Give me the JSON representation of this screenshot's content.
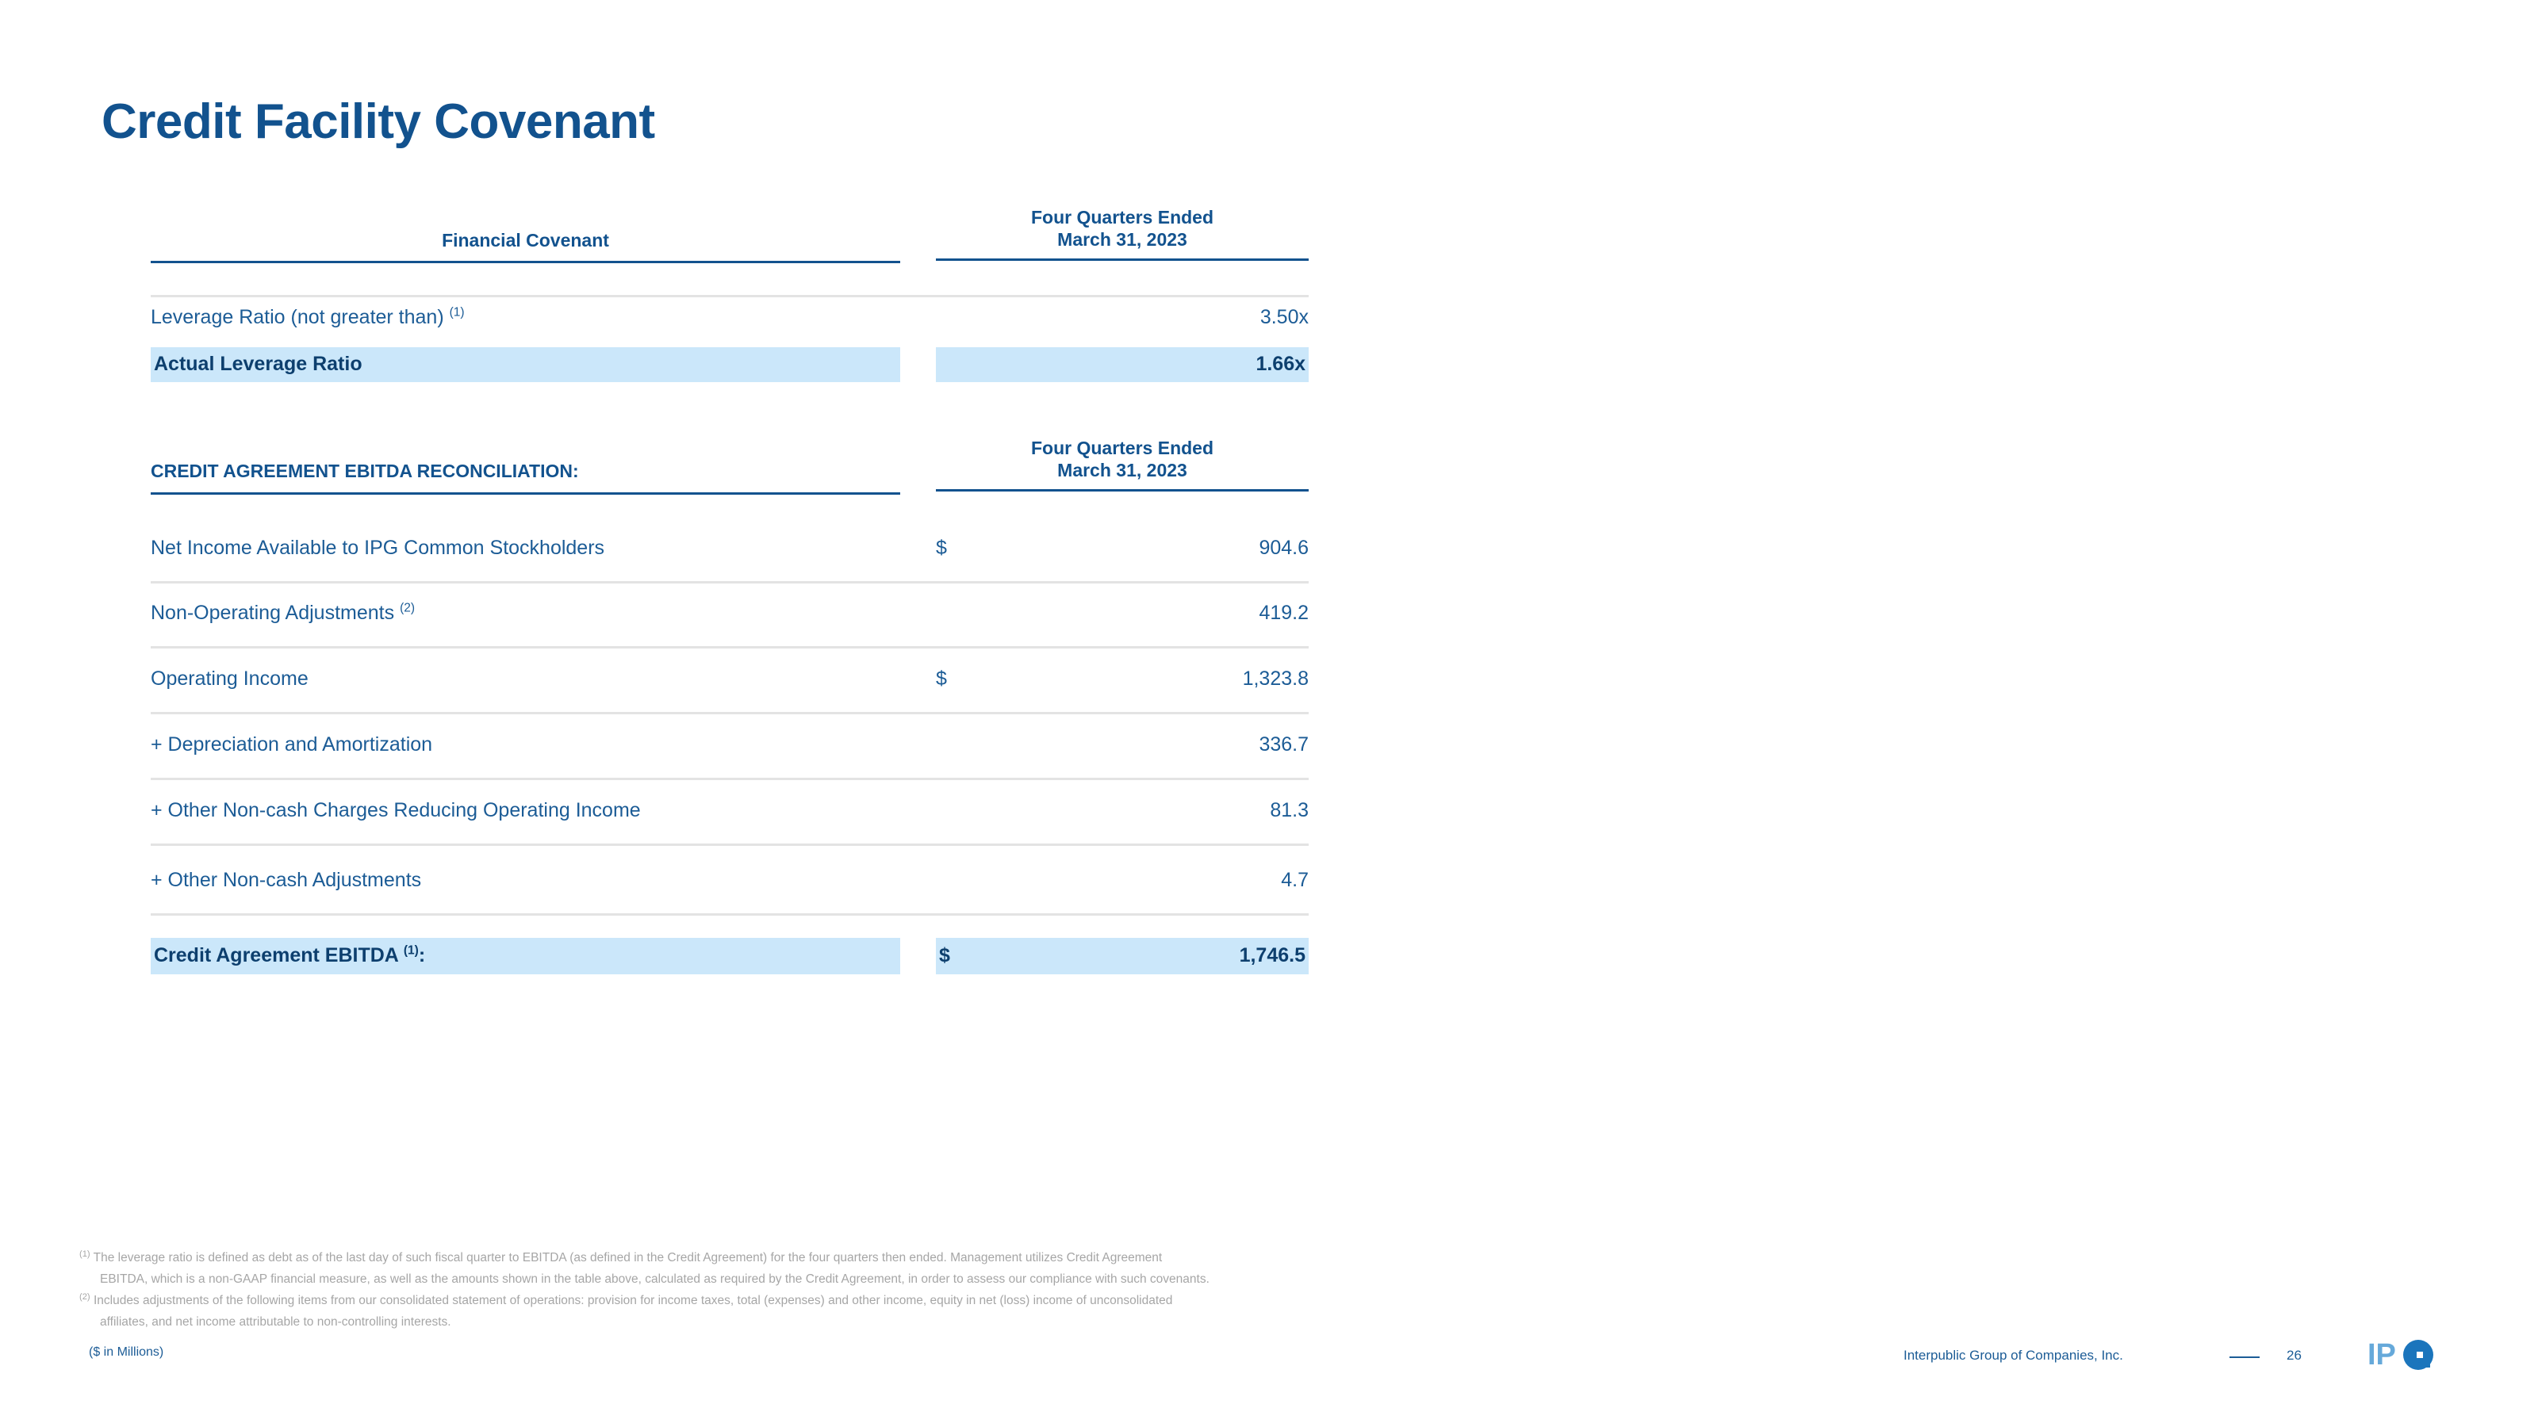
{
  "slide": {
    "title": "Credit Facility Covenant",
    "units_note": "($ in Millions)"
  },
  "covenant_table": {
    "header": {
      "label_col": "Financial Covenant",
      "value_col_line1": "Four Quarters Ended",
      "value_col_line2": "March 31, 2023"
    },
    "rows": [
      {
        "label": "Leverage Ratio (not greater than)",
        "footnote_marker": "(1)",
        "currency": "",
        "value": "3.50x",
        "highlighted": false,
        "bold": false
      },
      {
        "label": "Actual Leverage Ratio",
        "footnote_marker": "",
        "currency": "",
        "value": "1.66x",
        "highlighted": true,
        "bold": true
      }
    ]
  },
  "ebitda_table": {
    "header": {
      "label_col": "CREDIT AGREEMENT EBITDA RECONCILIATION:",
      "value_col_line1": "Four Quarters Ended",
      "value_col_line2": "March 31, 2023"
    },
    "rows": [
      {
        "label": "Net Income Available to IPG Common Stockholders",
        "footnote_marker": "",
        "currency": "$",
        "value": "904.6",
        "highlighted": false,
        "bold": false
      },
      {
        "label": "Non-Operating Adjustments",
        "footnote_marker": "(2)",
        "currency": "",
        "value": "419.2",
        "highlighted": false,
        "bold": false
      },
      {
        "label": "Operating Income",
        "footnote_marker": "",
        "currency": "$",
        "value": "1,323.8",
        "highlighted": false,
        "bold": false
      },
      {
        "label": "+ Depreciation and Amortization",
        "footnote_marker": "",
        "currency": "",
        "value": "336.7",
        "highlighted": false,
        "bold": false
      },
      {
        "label": "+ Other Non-cash Charges Reducing Operating Income",
        "footnote_marker": "",
        "currency": "",
        "value": "81.3",
        "highlighted": false,
        "bold": false
      },
      {
        "label": "+ Other Non-cash Adjustments",
        "footnote_marker": "",
        "currency": "",
        "value": "4.7",
        "highlighted": false,
        "bold": false
      },
      {
        "label": "Credit Agreement EBITDA",
        "footnote_marker": "(1)",
        "label_suffix": ":",
        "currency": "$",
        "value": "1,746.5",
        "highlighted": true,
        "bold": true
      }
    ]
  },
  "footnotes": [
    {
      "marker": "(1)",
      "line1": "The leverage ratio is defined as debt as of the last day of such fiscal quarter to EBITDA (as defined in the Credit Agreement) for the four quarters then ended.  Management utilizes Credit Agreement",
      "line2": "EBITDA, which is a non-GAAP financial measure, as well as the amounts shown in the table above, calculated as required by the Credit Agreement, in order to assess our compliance with such covenants."
    },
    {
      "marker": "(2)",
      "line1": "Includes adjustments of the following items from our consolidated statement of operations: provision for income taxes, total (expenses) and other income, equity in net (loss) income of unconsolidated",
      "line2": "affiliates, and net income attributable to non-controlling interests."
    }
  ],
  "footer": {
    "company": "Interpublic Group of Companies, Inc.",
    "page_number": "26",
    "logo_text_light": "IP",
    "logo_text_dark": "G"
  },
  "colors": {
    "title_blue": "#12528e",
    "body_blue": "#1c5c96",
    "bold_blue": "#0d3f6e",
    "highlight": "#cbe7fa",
    "rule_dark": "#12528e",
    "rule_gray": "#e3e3e3",
    "footnote_gray": "#a6a6a6",
    "logo_light": "#66a9da",
    "logo_dark": "#1b75bc"
  }
}
